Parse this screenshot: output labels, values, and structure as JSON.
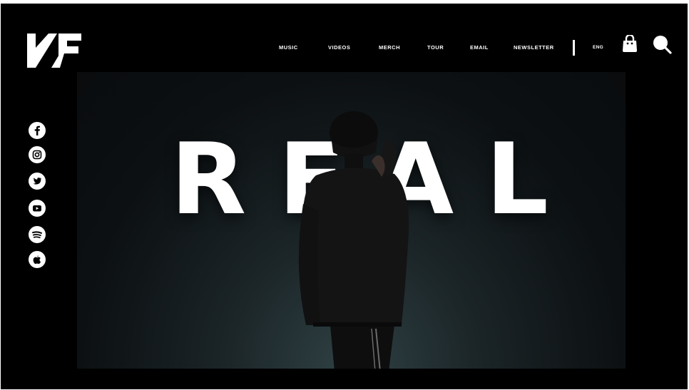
{
  "header": {
    "logo_text": "NF",
    "nav": [
      {
        "label": "MUSIC"
      },
      {
        "label": "VIDEOS"
      },
      {
        "label": "MERCH"
      },
      {
        "label": "TOUR"
      },
      {
        "label": "EMAIL"
      },
      {
        "label": "NEWSLETTER"
      }
    ],
    "language": "ENG",
    "icons": {
      "cart": "shopping-bag-icon",
      "search": "search-icon"
    }
  },
  "social": [
    {
      "name": "facebook-icon"
    },
    {
      "name": "instagram-icon"
    },
    {
      "name": "twitter-icon"
    },
    {
      "name": "youtube-icon"
    },
    {
      "name": "spotify-icon"
    },
    {
      "name": "apple-music-icon"
    }
  ],
  "hero": {
    "title_letters": [
      "R",
      "E",
      "A",
      "L"
    ]
  },
  "colors": {
    "background": "#000000",
    "text": "#ffffff",
    "hero_glow": "#2f4144"
  }
}
